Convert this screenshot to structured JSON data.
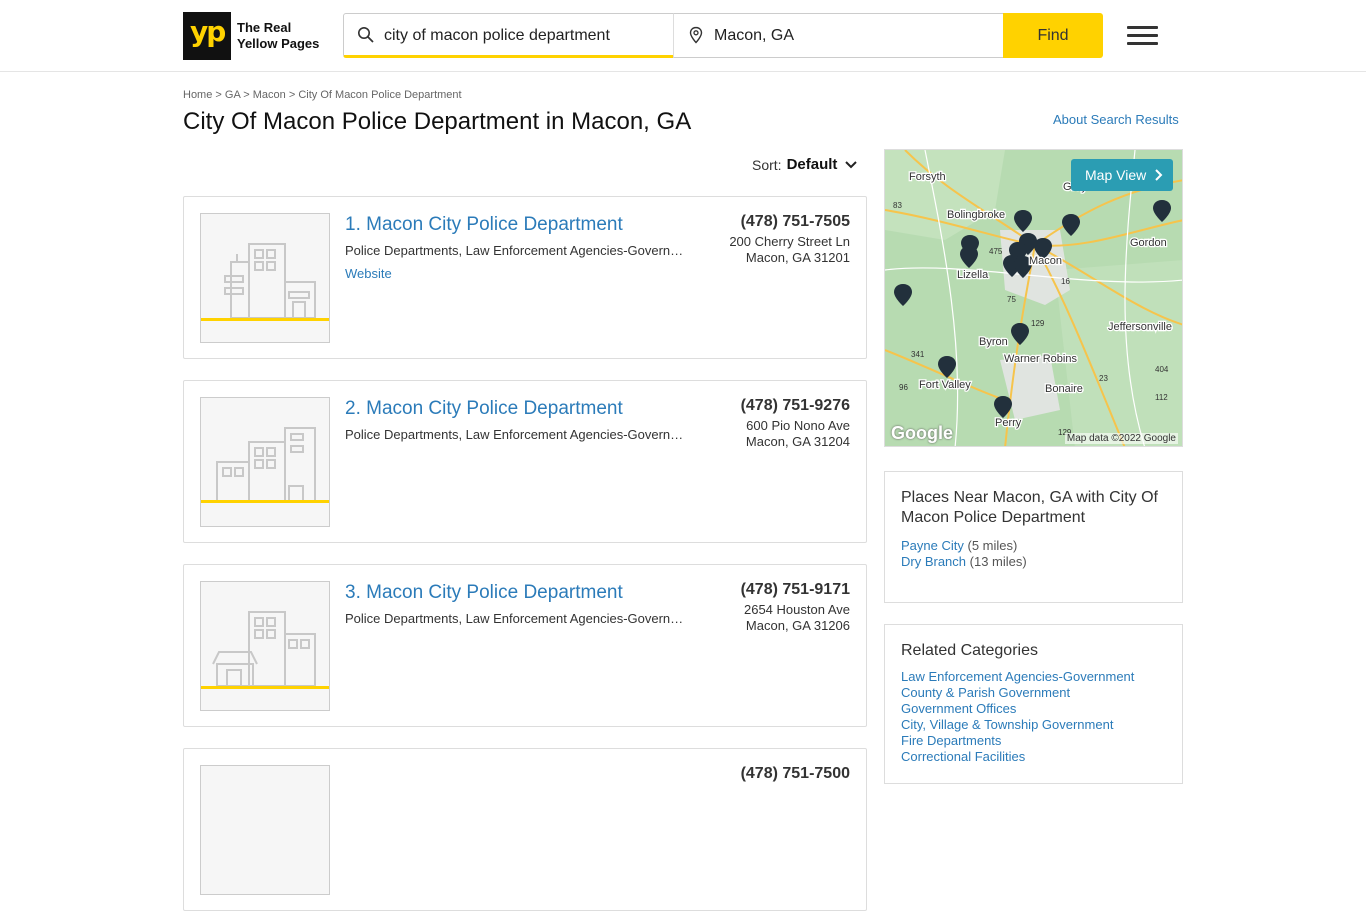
{
  "logo": {
    "mark": "yp",
    "line1": "The Real",
    "line2": "Yellow Pages"
  },
  "search": {
    "what_value": "city of macon police department",
    "where_value": "Macon, GA",
    "find_label": "Find"
  },
  "breadcrumb": {
    "home": "Home",
    "state": "GA",
    "city": "Macon",
    "current": "City Of Macon Police Department",
    "sep": ">"
  },
  "page_title": "City Of Macon Police Department in Macon, GA",
  "about_link": "About Search Results",
  "sort": {
    "label": "Sort:",
    "value": "Default"
  },
  "results": [
    {
      "name": "1. Macon City Police Department",
      "categories": "Police Departments, Law Enforcement Agencies-Government",
      "website": "Website",
      "phone": "(478) 751-7505",
      "street": "200 Cherry Street Ln",
      "city": "Macon, GA 31201"
    },
    {
      "name": "2. Macon City Police Department",
      "categories": "Police Departments, Law Enforcement Agencies-Government",
      "phone": "(478) 751-9276",
      "street": "600 Pio Nono Ave",
      "city": "Macon, GA 31204"
    },
    {
      "name": "3. Macon City Police Department",
      "categories": "Police Departments, Law Enforcement Agencies-Government",
      "phone": "(478) 751-9171",
      "street": "2654 Houston Ave",
      "city": "Macon, GA 31206"
    },
    {
      "phone": "(478) 751-7500"
    }
  ],
  "map": {
    "button": "Map View",
    "attribution": "Map data ©2022 Google",
    "google": "Google",
    "places": [
      "Forsyth",
      "Bolingbroke",
      "Gray",
      "Gordon",
      "Lizella",
      "Macon",
      "Byron",
      "Warner Robins",
      "Jeffersonville",
      "Fort Valley",
      "Bonaire",
      "Perry"
    ],
    "shields": [
      "83",
      "475",
      "75",
      "16",
      "129",
      "341",
      "96",
      "23",
      "404",
      "112",
      "129"
    ]
  },
  "places_near": {
    "title": "Places Near Macon, GA with City Of Macon Police Department",
    "items": [
      {
        "name": "Payne City",
        "dist": "(5 miles)"
      },
      {
        "name": "Dry Branch",
        "dist": "(13 miles)"
      }
    ]
  },
  "related": {
    "title": "Related Categories",
    "items": [
      "Law Enforcement Agencies-Government",
      "County & Parish Government",
      "Government Offices",
      "City, Village & Township Government",
      "Fire Departments",
      "Correctional Facilities"
    ]
  },
  "colors": {
    "brand_yellow": "#ffd200",
    "link_blue": "#2b7bb9",
    "map_button": "#2b9db3"
  }
}
